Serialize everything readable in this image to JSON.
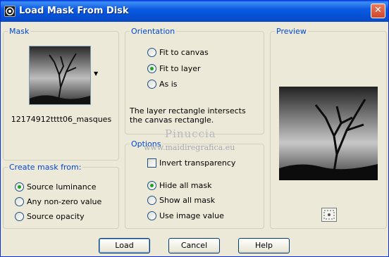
{
  "window": {
    "title": "Load Mask From Disk",
    "close_glyph": "✕"
  },
  "mask": {
    "legend": "Mask",
    "file_name": "12174912tttt06_masques",
    "dropdown_glyph": "▼"
  },
  "orientation": {
    "legend": "Orientation",
    "options": [
      {
        "label": "Fit to canvas",
        "checked": false
      },
      {
        "label": "Fit to layer",
        "checked": true
      },
      {
        "label": "As is",
        "checked": false
      }
    ],
    "description": "The layer rectangle intersects the canvas rectangle."
  },
  "options": {
    "legend": "Options",
    "invert_label": "Invert transparency",
    "invert_checked": false,
    "radios": [
      {
        "label": "Hide all mask",
        "checked": true
      },
      {
        "label": "Show all mask",
        "checked": false
      },
      {
        "label": "Use image value",
        "checked": false
      }
    ]
  },
  "create_from": {
    "legend": "Create mask from:",
    "radios": [
      {
        "label": "Source luminance",
        "checked": true
      },
      {
        "label": "Any non-zero value",
        "checked": false
      },
      {
        "label": "Source opacity",
        "checked": false
      }
    ]
  },
  "preview": {
    "legend": "Preview",
    "zoom_icon": "zoom-fit-icon"
  },
  "watermark": {
    "name": "Pinuccia",
    "url": "www.maidiregrafica.eu"
  },
  "buttons": {
    "load": "Load",
    "cancel": "Cancel",
    "help": "Help"
  }
}
